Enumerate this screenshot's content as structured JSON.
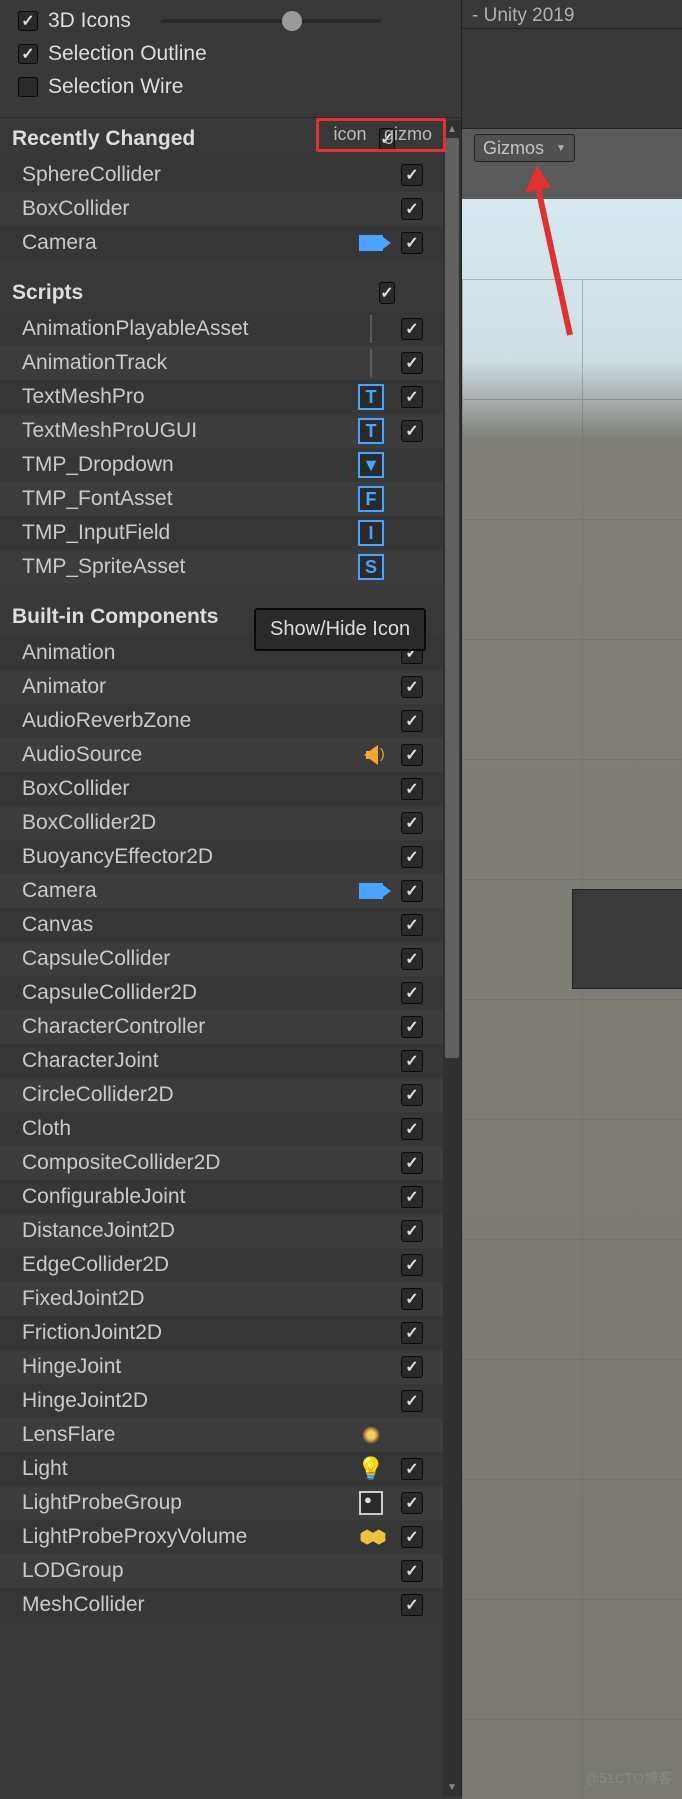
{
  "titleBar": "- Unity 2019",
  "gizmosBtn": "Gizmos",
  "topOptions": {
    "icons3d": {
      "label": "3D Icons",
      "checked": true
    },
    "selectionOutline": {
      "label": "Selection Outline",
      "checked": true
    },
    "selectionWire": {
      "label": "Selection Wire",
      "checked": false
    }
  },
  "columnHeaders": {
    "icon": "icon",
    "gizmo": "gizmo"
  },
  "tooltip": "Show/Hide Icon",
  "sections": [
    {
      "title": "Recently Changed",
      "headerGizmo": true,
      "items": [
        {
          "label": "SphereCollider",
          "icon": null,
          "gizmo": true
        },
        {
          "label": "BoxCollider",
          "icon": null,
          "gizmo": true
        },
        {
          "label": "Camera",
          "icon": "camera",
          "gizmo": true
        }
      ]
    },
    {
      "title": "Scripts",
      "headerGizmo": true,
      "items": [
        {
          "label": "AnimationPlayableAsset",
          "icon": null,
          "iconSep": true,
          "gizmo": true
        },
        {
          "label": "AnimationTrack",
          "icon": null,
          "iconSep": true,
          "gizmo": true
        },
        {
          "label": "TextMeshPro",
          "icon": "T",
          "iconBox": true,
          "gizmo": true
        },
        {
          "label": "TextMeshProUGUI",
          "icon": "T",
          "iconBox": true,
          "gizmo": true
        },
        {
          "label": "TMP_Dropdown",
          "icon": "▼",
          "iconBox": true,
          "gizmo": null
        },
        {
          "label": "TMP_FontAsset",
          "icon": "F",
          "iconBox": true,
          "gizmo": null
        },
        {
          "label": "TMP_InputField",
          "icon": "I",
          "iconBox": true,
          "gizmo": null
        },
        {
          "label": "TMP_SpriteAsset",
          "icon": "S",
          "iconBox": true,
          "gizmo": null
        }
      ]
    },
    {
      "title": "Built-in Components",
      "headerGizmo": null,
      "items": [
        {
          "label": "Animation",
          "icon": null,
          "gizmo": true
        },
        {
          "label": "Animator",
          "icon": null,
          "gizmo": true
        },
        {
          "label": "AudioReverbZone",
          "icon": null,
          "gizmo": true
        },
        {
          "label": "AudioSource",
          "icon": "speaker",
          "gizmo": true
        },
        {
          "label": "BoxCollider",
          "icon": null,
          "gizmo": true
        },
        {
          "label": "BoxCollider2D",
          "icon": null,
          "gizmo": true
        },
        {
          "label": "BuoyancyEffector2D",
          "icon": null,
          "gizmo": true
        },
        {
          "label": "Camera",
          "icon": "camera",
          "gizmo": true
        },
        {
          "label": "Canvas",
          "icon": null,
          "gizmo": true
        },
        {
          "label": "CapsuleCollider",
          "icon": null,
          "gizmo": true
        },
        {
          "label": "CapsuleCollider2D",
          "icon": null,
          "gizmo": true
        },
        {
          "label": "CharacterController",
          "icon": null,
          "gizmo": true
        },
        {
          "label": "CharacterJoint",
          "icon": null,
          "gizmo": true
        },
        {
          "label": "CircleCollider2D",
          "icon": null,
          "gizmo": true
        },
        {
          "label": "Cloth",
          "icon": null,
          "gizmo": true
        },
        {
          "label": "CompositeCollider2D",
          "icon": null,
          "gizmo": true
        },
        {
          "label": "ConfigurableJoint",
          "icon": null,
          "gizmo": true
        },
        {
          "label": "DistanceJoint2D",
          "icon": null,
          "gizmo": true
        },
        {
          "label": "EdgeCollider2D",
          "icon": null,
          "gizmo": true
        },
        {
          "label": "FixedJoint2D",
          "icon": null,
          "gizmo": true
        },
        {
          "label": "FrictionJoint2D",
          "icon": null,
          "gizmo": true
        },
        {
          "label": "HingeJoint",
          "icon": null,
          "gizmo": true
        },
        {
          "label": "HingeJoint2D",
          "icon": null,
          "gizmo": true
        },
        {
          "label": "LensFlare",
          "icon": "flare",
          "gizmo": null
        },
        {
          "label": "Light",
          "icon": "light",
          "gizmo": true
        },
        {
          "label": "LightProbeGroup",
          "icon": "probe",
          "gizmo": true
        },
        {
          "label": "LightProbeProxyVolume",
          "icon": "proxy",
          "gizmo": true
        },
        {
          "label": "LODGroup",
          "icon": null,
          "gizmo": true
        },
        {
          "label": "MeshCollider",
          "icon": null,
          "gizmo": true
        }
      ]
    }
  ],
  "watermark": "@51CTO博客"
}
